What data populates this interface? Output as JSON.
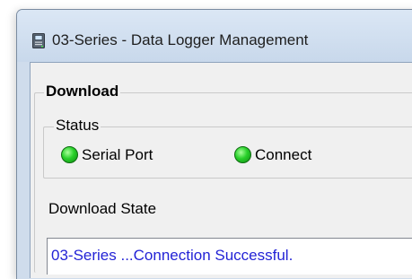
{
  "window": {
    "title": "03-Series  - Data Logger Management"
  },
  "download": {
    "group_label": "Download",
    "status": {
      "group_label": "Status",
      "indicators": [
        {
          "label": "Serial Port",
          "state": "ok",
          "color": "#22cc22"
        },
        {
          "label": "Connect",
          "state": "ok",
          "color": "#22cc22"
        }
      ]
    },
    "state_label": "Download State",
    "state_text": "03-Series ...Connection Successful."
  },
  "icons": {
    "app_icon": "data-logger-app-icon",
    "indicator_icon": "green-led-icon"
  }
}
